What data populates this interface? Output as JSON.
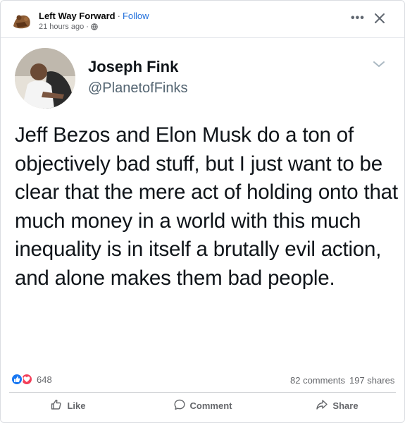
{
  "post": {
    "page_name": "Left Way Forward",
    "separator": "·",
    "follow_label": "Follow",
    "timestamp": "21 hours ago",
    "meta_separator": "·"
  },
  "tweet": {
    "name": "Joseph Fink",
    "handle": "@PlanetofFinks",
    "text": "Jeff Bezos and Elon Musk do a ton of objectively bad stuff, but I just want to be clear that the mere act of holding onto that much money in a world with this much inequality is in itself a brutally evil action, and alone makes them bad people."
  },
  "stats": {
    "reaction_count": "648",
    "comments": "82 comments",
    "shares": "197 shares"
  },
  "actions": {
    "like": "Like",
    "comment": "Comment",
    "share": "Share"
  },
  "icons": {
    "reactions": [
      "like-icon",
      "love-icon"
    ],
    "header": [
      "globe-icon",
      "more-icon",
      "close-icon"
    ],
    "tweet": [
      "chevron-down-icon"
    ]
  },
  "colors": {
    "follow": "#216fdb",
    "like_reaction": "#1877f2",
    "love_reaction": "#f33e58",
    "muted_text": "#65676b"
  }
}
